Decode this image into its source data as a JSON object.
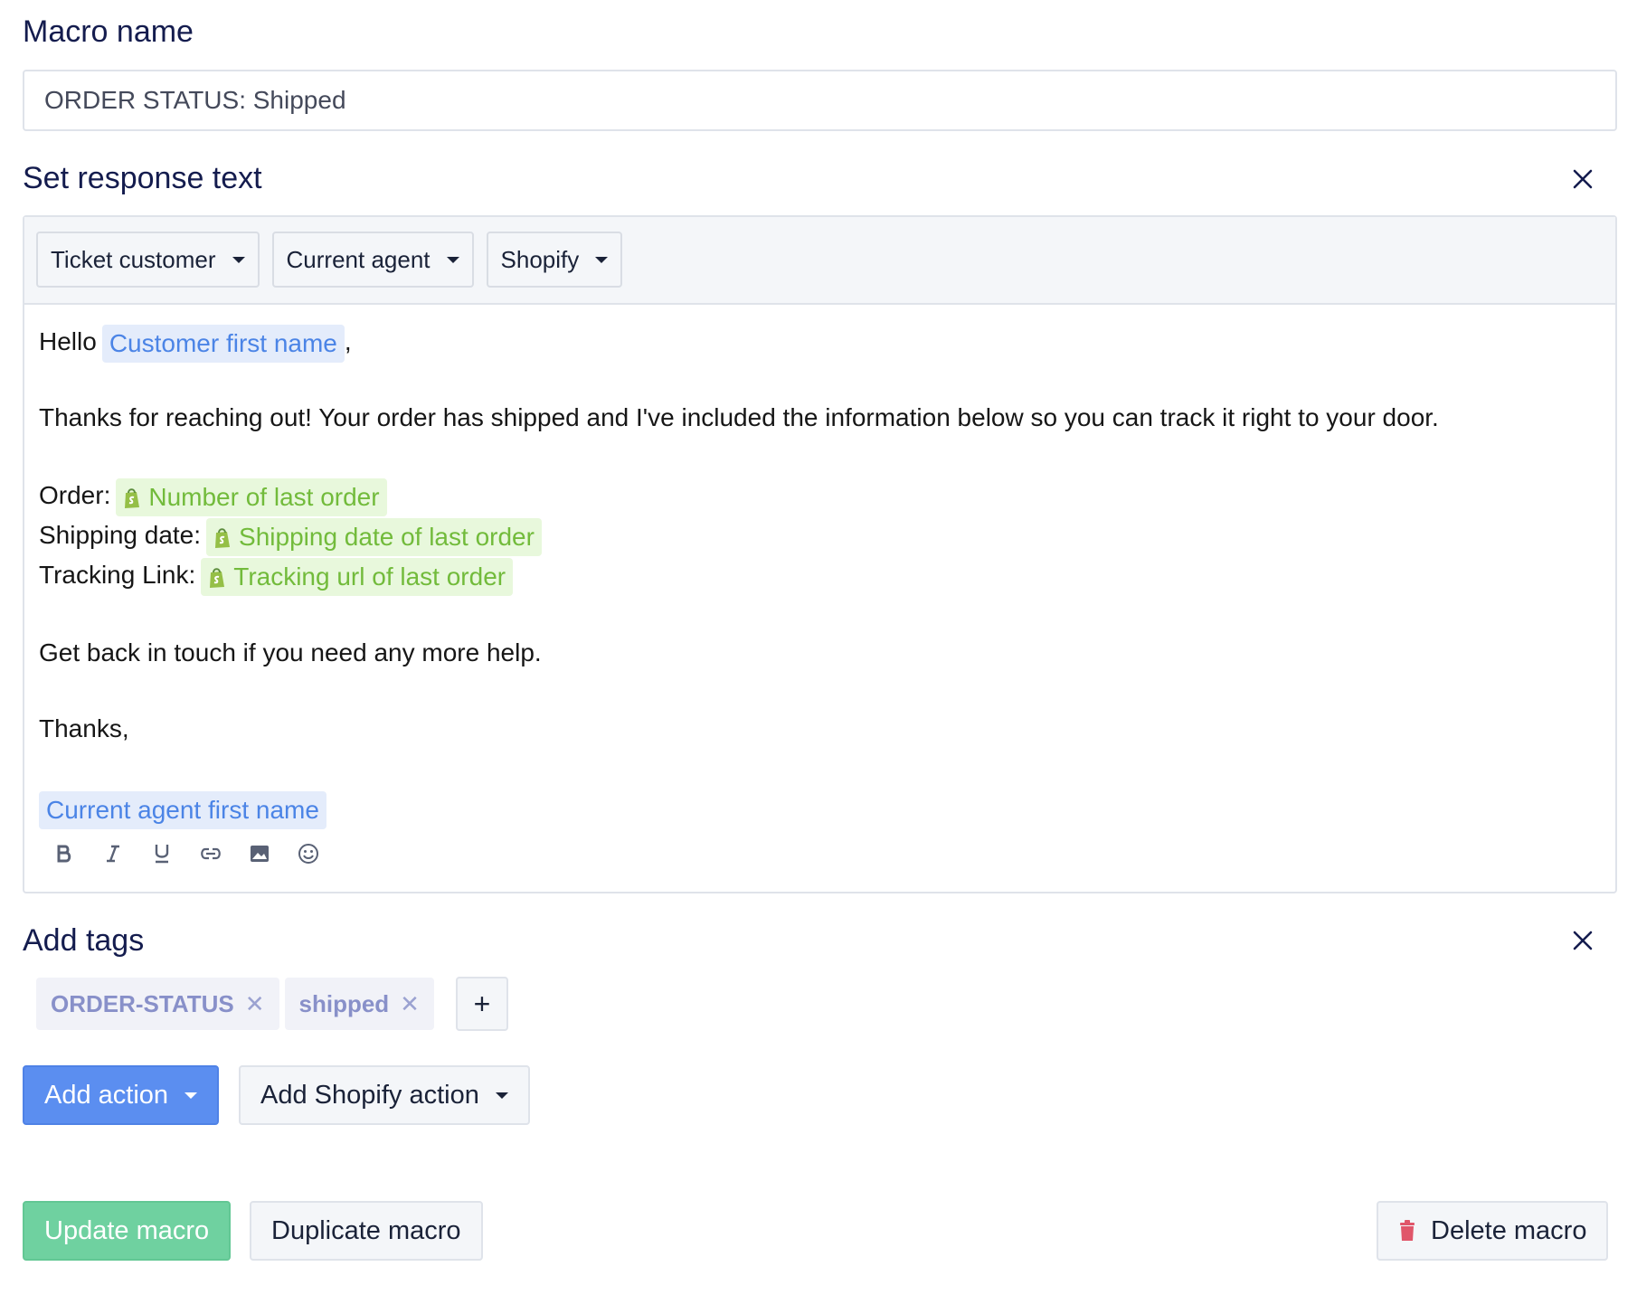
{
  "macro_name": {
    "label": "Macro name",
    "value": "ORDER STATUS: Shipped"
  },
  "response": {
    "label": "Set response text",
    "close_icon": "close-icon",
    "variable_menus": [
      "Ticket customer",
      "Current agent",
      "Shopify"
    ],
    "body": {
      "greeting": "Hello",
      "customer_first_name": "Customer first name",
      "greeting_suffix": ",",
      "paragraph": "Thanks for reaching out! Your order has shipped and I've included the information below so you can track it right to your door.",
      "order_label": "Order:",
      "order_var": "Number of last order",
      "shipping_label": "Shipping date:",
      "shipping_var": "Shipping date of last order",
      "tracking_label": "Tracking Link:",
      "tracking_var": "Tracking url of last order",
      "help_line": "Get back in touch if you need any more help.",
      "sign_off": "Thanks,",
      "agent_first_name": "Current agent first name"
    },
    "format_tools": [
      "bold-icon",
      "italic-icon",
      "underline-icon",
      "link-icon",
      "image-icon",
      "emoji-icon"
    ],
    "colors": {
      "agent_var": "#4b84e6",
      "shopify_var": "#72bb3b"
    }
  },
  "tags": {
    "label": "Add tags",
    "items": [
      "ORDER-STATUS",
      "shipped"
    ],
    "add_label": "+"
  },
  "actions": {
    "add_action": "Add action",
    "add_shopify_action": "Add Shopify action"
  },
  "footer": {
    "update": "Update macro",
    "duplicate": "Duplicate macro",
    "delete": "Delete macro"
  }
}
